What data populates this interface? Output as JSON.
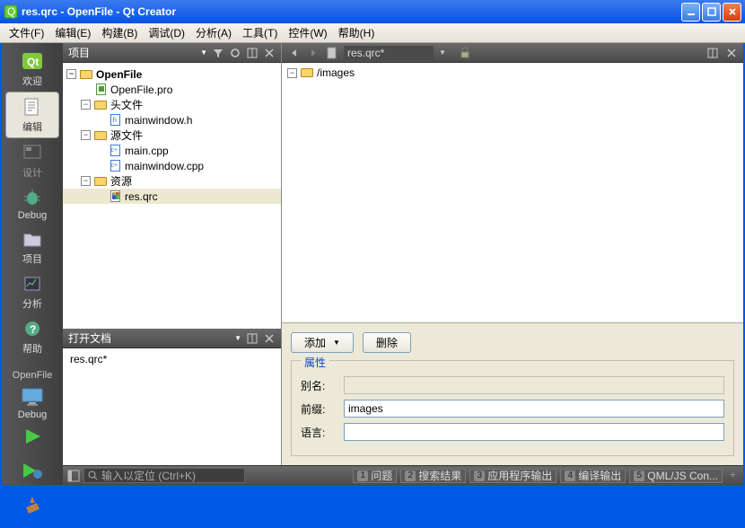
{
  "window": {
    "title": "res.qrc - OpenFile - Qt Creator"
  },
  "menu": {
    "file": "文件(F)",
    "edit": "编辑(E)",
    "build": "构建(B)",
    "debug": "调试(D)",
    "analyze": "分析(A)",
    "tools": "工具(T)",
    "widgets": "控件(W)",
    "help": "帮助(H)"
  },
  "modes": {
    "welcome": "欢迎",
    "edit": "编辑",
    "design": "设计",
    "debug": "Debug",
    "projects": "项目",
    "analyze": "分析",
    "help": "帮助",
    "project_name": "OpenFile",
    "debug_kit": "Debug"
  },
  "project_panel": {
    "title": "项目"
  },
  "tree": {
    "root": "OpenFile",
    "pro": "OpenFile.pro",
    "headers": "头文件",
    "mainwindow_h": "mainwindow.h",
    "sources": "源文件",
    "main_cpp": "main.cpp",
    "mainwindow_cpp": "mainwindow.cpp",
    "resources": "资源",
    "res_qrc": "res.qrc"
  },
  "opendocs": {
    "title": "打开文档",
    "doc0": "res.qrc*"
  },
  "editor": {
    "file_combo": "res.qrc*",
    "qrc_prefix": "/images"
  },
  "qrc_form": {
    "add": "添加",
    "remove": "删除",
    "legend": "属性",
    "alias_label": "别名:",
    "prefix_label": "前缀:",
    "lang_label": "语言:",
    "alias_value": "",
    "prefix_value": "images",
    "lang_value": ""
  },
  "bottombar": {
    "locator_placeholder": "输入以定位 (Ctrl+K)",
    "issues": "问题",
    "search": "搜索结果",
    "appout": "应用程序输出",
    "compout": "编译输出",
    "qmljs": "QML/JS Con..."
  }
}
